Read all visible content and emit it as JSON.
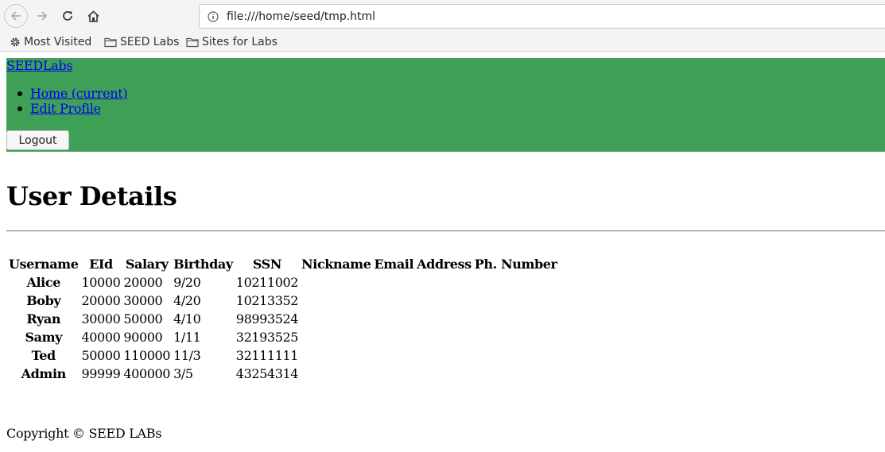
{
  "browser": {
    "url": "file:///home/seed/tmp.html",
    "bookmarks": [
      {
        "label": "Most Visited",
        "icon": "gear-icon"
      },
      {
        "label": "SEED Labs",
        "icon": "folder-icon"
      },
      {
        "label": "Sites for Labs",
        "icon": "folder-icon"
      }
    ]
  },
  "navbar": {
    "brand": "SEEDLabs",
    "links": [
      {
        "label": "Home (current)"
      },
      {
        "label": "Edit Profile"
      }
    ],
    "logout_label": "Logout",
    "bg_color": "#3ea157"
  },
  "page": {
    "title": "User Details"
  },
  "table": {
    "headers": [
      "Username",
      "EId",
      "Salary",
      "Birthday",
      "SSN",
      "Nickname",
      "Email",
      "Address",
      "Ph. Number"
    ],
    "rows": [
      {
        "username": "Alice",
        "eid": "10000",
        "salary": "20000",
        "birthday": "9/20",
        "ssn": "10211002"
      },
      {
        "username": "Boby",
        "eid": "20000",
        "salary": "30000",
        "birthday": "4/20",
        "ssn": "10213352"
      },
      {
        "username": "Ryan",
        "eid": "30000",
        "salary": "50000",
        "birthday": "4/10",
        "ssn": "98993524"
      },
      {
        "username": "Samy",
        "eid": "40000",
        "salary": "90000",
        "birthday": "1/11",
        "ssn": "32193525"
      },
      {
        "username": "Ted",
        "eid": "50000",
        "salary": "110000",
        "birthday": "11/3",
        "ssn": "32111111"
      },
      {
        "username": "Admin",
        "eid": "99999",
        "salary": "400000",
        "birthday": "3/5",
        "ssn": "43254314"
      }
    ]
  },
  "footer": {
    "text": "Copyright © SEED LABs"
  }
}
